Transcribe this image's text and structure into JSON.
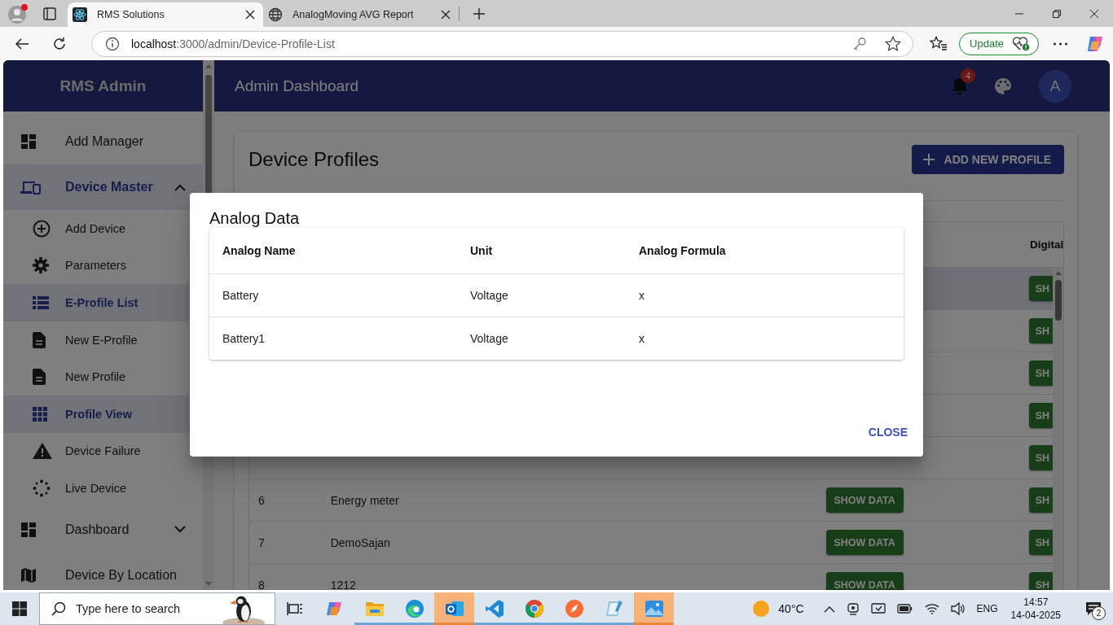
{
  "browser": {
    "tabs": [
      {
        "title": "RMS Solutions",
        "selected": true
      },
      {
        "title": "AnalogMoving AVG Report",
        "selected": false
      }
    ],
    "address": {
      "host": "localhost",
      "path": ":3000/admin/Device-Profile-List"
    },
    "update_button": "Update"
  },
  "sidebar": {
    "title": "RMS Admin",
    "items": [
      {
        "label": "Add Manager",
        "kind": "link",
        "selected": false
      },
      {
        "label": "Device Master",
        "kind": "group",
        "selected": true,
        "expanded": true,
        "children": [
          {
            "label": "Add Device",
            "selected": false
          },
          {
            "label": "Parameters",
            "selected": false
          },
          {
            "label": "E-Profile List",
            "selected": true
          },
          {
            "label": "New E-Profile",
            "selected": false
          },
          {
            "label": "New Profile",
            "selected": false
          },
          {
            "label": "Profile View",
            "selected": true
          },
          {
            "label": "Device Failure",
            "selected": false
          },
          {
            "label": "Live Device",
            "selected": false
          }
        ]
      },
      {
        "label": "Dashboard",
        "kind": "group",
        "selected": false,
        "expanded": false
      },
      {
        "label": "Device By Location",
        "kind": "link",
        "selected": false
      }
    ]
  },
  "header": {
    "title": "Admin Dashboard",
    "notification_count": "4",
    "avatar": "A"
  },
  "page": {
    "title": "Device Profiles",
    "add_button": "ADD NEW PROFILE",
    "table": {
      "columns": [
        "Digital"
      ],
      "rows": [
        {
          "selected": true,
          "digital": "SH"
        },
        {
          "selected": false,
          "digital": "SH"
        },
        {
          "selected": false,
          "digital": "SH"
        },
        {
          "selected": false,
          "digital": "SH"
        },
        {
          "selected": false,
          "digital": "SH"
        },
        {
          "selected": false,
          "number": "6",
          "name": "Energy meter",
          "action": "SHOW DATA",
          "digital": "SH"
        },
        {
          "selected": false,
          "number": "7",
          "name": "DemoSajan",
          "action": "SHOW DATA",
          "digital": "SH"
        },
        {
          "selected": false,
          "number": "8",
          "name": "1212",
          "action": "SHOW DATA",
          "digital": "SH"
        }
      ]
    }
  },
  "dialog": {
    "title": "Analog Data",
    "columns": [
      "Analog Name",
      "Unit",
      "Analog Formula"
    ],
    "rows": [
      [
        "Battery",
        "Voltage",
        "x"
      ],
      [
        "Battery1",
        "Voltage",
        "x"
      ]
    ],
    "close_button": "CLOSE"
  },
  "taskbar": {
    "search_placeholder": "Type here to search",
    "apps": [
      {
        "open": false,
        "flashing": false
      },
      {
        "open": true,
        "flashing": false
      },
      {
        "open": true,
        "flashing": false
      },
      {
        "open": true,
        "flashing": true
      },
      {
        "open": true,
        "flashing": false
      },
      {
        "open": true,
        "flashing": false
      },
      {
        "open": true,
        "flashing": false
      },
      {
        "open": true,
        "flashing": false
      },
      {
        "open": true,
        "flashing": true
      }
    ],
    "weather": "40°C",
    "language": "ENG",
    "time": "14:57",
    "date": "14-04-2025",
    "notifications": "2"
  }
}
